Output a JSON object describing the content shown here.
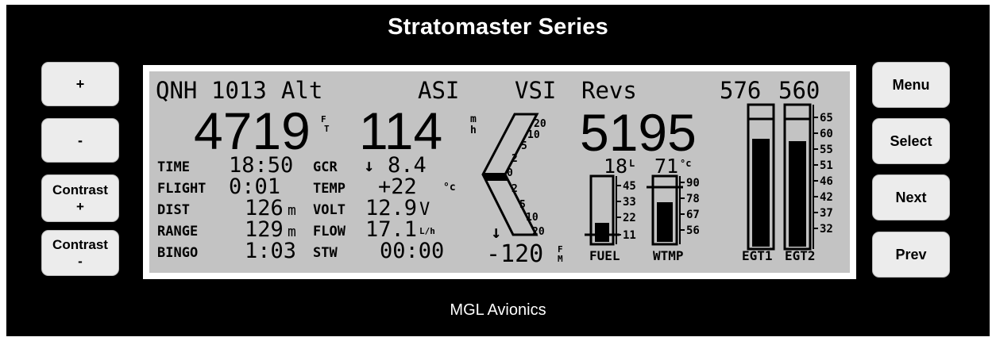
{
  "header": {
    "title": "Stratomaster Series"
  },
  "footer": {
    "maker": "MGL Avionics"
  },
  "left_buttons": {
    "plus": "+",
    "minus": "-",
    "contrast_plus_line1": "Contrast",
    "contrast_plus_line2": "+",
    "contrast_minus_line1": "Contrast",
    "contrast_minus_line2": "-"
  },
  "right_buttons": {
    "menu": "Menu",
    "select": "Select",
    "next": "Next",
    "prev": "Prev"
  },
  "display": {
    "top_labels": {
      "qnh": "QNH",
      "qnh_value": "1013",
      "alt": "Alt",
      "asi": "ASI",
      "vsi": "VSI",
      "revs": "Revs",
      "egt1_value": "576",
      "egt2_value": "560"
    },
    "altitude": {
      "value": "4719",
      "unit_top": "F",
      "unit_bottom": "T"
    },
    "airspeed": {
      "value": "114",
      "unit_top": "m",
      "unit_bottom": "h"
    },
    "rpm": {
      "value": "5195"
    },
    "stats": [
      {
        "label": "TIME",
        "value": "18:50",
        "unit": ""
      },
      {
        "label": "FLIGHT",
        "value": "0:01",
        "unit": ""
      },
      {
        "label": "DIST",
        "value": "126",
        "unit": "m"
      },
      {
        "label": "RANGE",
        "value": "129",
        "unit": "m"
      },
      {
        "label": "BINGO",
        "value": "1:03",
        "unit": ""
      }
    ],
    "engine": [
      {
        "label": "GCR",
        "value": "8.4",
        "unit": ""
      },
      {
        "label": "TEMP",
        "value": "+22",
        "unit": "°c"
      },
      {
        "label": "VOLT",
        "value": "12.9",
        "unit": "V"
      },
      {
        "label": "FLOW",
        "value": "17.1",
        "unit": "L/h"
      },
      {
        "label": "STW",
        "value": "00:00",
        "unit": ""
      }
    ],
    "vsi": {
      "value": "-120",
      "unit_top": "F",
      "unit_bottom": "M",
      "scale_up": [
        "20",
        "10",
        "5",
        "2"
      ],
      "zero": "0",
      "scale_down": [
        "2",
        "5",
        "10",
        "20"
      ],
      "needle_level": 0
    },
    "fuel": {
      "readout": "18",
      "readout_unit": "L",
      "label": "FUEL",
      "scale": [
        "45",
        "33",
        "22",
        "11"
      ],
      "level": 0.3
    },
    "water_temp": {
      "readout": "71",
      "readout_unit": "°c",
      "label": "WTMP",
      "scale": [
        "90",
        "78",
        "67",
        "56"
      ],
      "level": 0.62
    },
    "egt": {
      "labels": [
        "EGT1",
        "EGT2"
      ],
      "scale": [
        "65",
        "60",
        "55",
        "51",
        "46",
        "42",
        "37",
        "32"
      ],
      "levels": [
        0.86,
        0.84
      ]
    }
  }
}
